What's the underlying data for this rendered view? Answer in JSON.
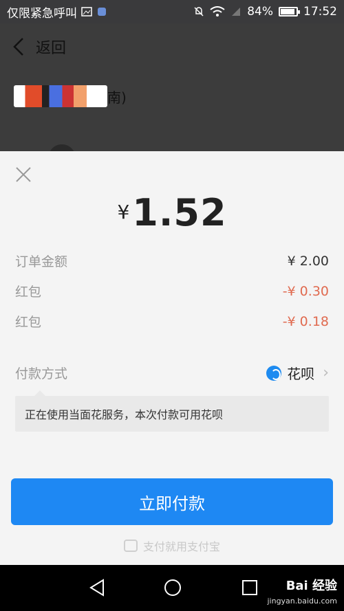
{
  "status_bar": {
    "carrier": "仅限紧急呼叫",
    "battery_percent": "84%",
    "battery_level": 0.84,
    "time": "17:52"
  },
  "background": {
    "back_label": "返回",
    "merchant_suffix": "南)"
  },
  "sheet": {
    "amount_currency": "¥",
    "amount_value": "1.52",
    "rows": [
      {
        "label": "订单金额",
        "value": "¥ 2.00",
        "red": false
      },
      {
        "label": "红包",
        "value": "-¥ 0.30",
        "red": true
      },
      {
        "label": "红包",
        "value": "-¥ 0.18",
        "red": true
      }
    ],
    "payment_method_label": "付款方式",
    "payment_method_value": "花呗",
    "tip_text": "正在使用当面花服务，本次付款可用花呗",
    "pay_button_label": "立即付款",
    "footer_text": "支付就用支付宝"
  },
  "nav": {
    "watermark": "Bai 经验",
    "watermark_sub": "jingyan.baidu.com"
  }
}
